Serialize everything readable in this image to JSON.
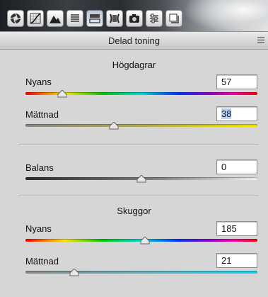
{
  "toolbar": {
    "icons": [
      "aperture-icon",
      "curve-icon",
      "mountains-icon",
      "lines-icon",
      "split-toning-icon",
      "lens-icon",
      "camera-icon",
      "sliders-icon",
      "presets-icon"
    ],
    "active_index": 4
  },
  "panel": {
    "title": "Delad toning"
  },
  "highlights": {
    "title": "Högdagrar",
    "hue": {
      "label": "Nyans",
      "value": "57",
      "fraction": 0.158
    },
    "saturation": {
      "label": "Mättnad",
      "value": "38",
      "fraction": 0.38
    }
  },
  "balance": {
    "label": "Balans",
    "value": "0",
    "fraction": 0.5
  },
  "shadows": {
    "title": "Skuggor",
    "hue": {
      "label": "Nyans",
      "value": "185",
      "fraction": 0.514
    },
    "saturation": {
      "label": "Mättnad",
      "value": "21",
      "fraction": 0.21
    }
  },
  "colors": {
    "highlight_sat_end": "#f2e600",
    "shadow_sat_end": "#17d3f0"
  }
}
